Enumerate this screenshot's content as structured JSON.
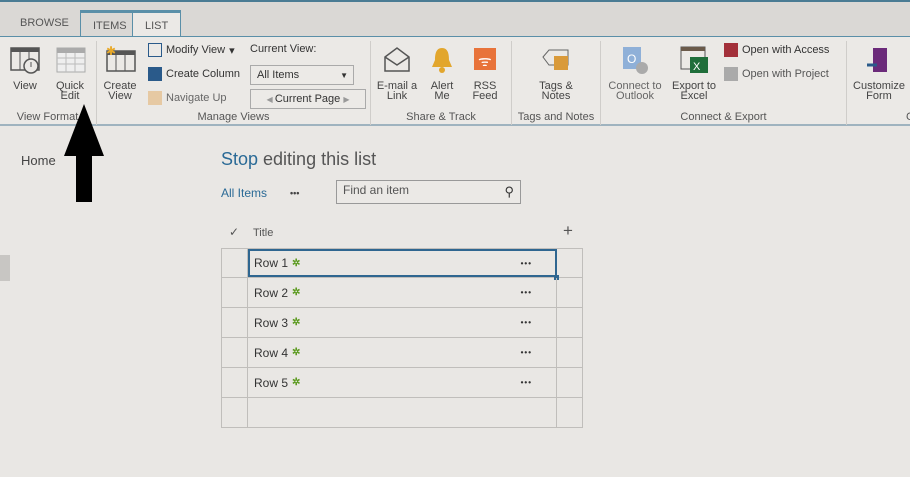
{
  "tabs": [
    {
      "label": "BROWSE"
    },
    {
      "label": "ITEMS"
    },
    {
      "label": "LIST"
    }
  ],
  "ribbon": {
    "view_format": {
      "label": "View Format",
      "view": "View",
      "quick_edit": "Quick Edit"
    },
    "manage_views": {
      "label": "Manage Views",
      "create_view": "Create View",
      "modify_view": "Modify View",
      "create_column": "Create Column",
      "navigate_up": "Navigate Up",
      "current_view_label": "Current View:",
      "current_view_value": "All Items",
      "current_page": "Current Page"
    },
    "share_track": {
      "label": "Share & Track",
      "email": "E-mail a Link",
      "alert": "Alert Me",
      "rss": "RSS Feed"
    },
    "tags": {
      "label": "Tags and Notes",
      "tags_notes": "Tags & Notes"
    },
    "connect": {
      "label": "Connect & Export",
      "outlook": "Connect to Outlook",
      "excel": "Export to Excel",
      "access": "Open with Access",
      "project": "Open with Project"
    },
    "customize": {
      "label": "C",
      "form": "Customize Form"
    }
  },
  "nav": {
    "home": "Home"
  },
  "main": {
    "stop": "Stop",
    "title_rest": " editing this list",
    "view": "All Items",
    "dots": "•••",
    "search_placeholder": "Find an item",
    "col_check": "✓",
    "col_title": "Title",
    "add": "+",
    "rows": [
      {
        "title": "Row 1"
      },
      {
        "title": "Row 2"
      },
      {
        "title": "Row 3"
      },
      {
        "title": "Row 4"
      },
      {
        "title": "Row 5"
      }
    ],
    "new_mark": "✲",
    "more": "•••"
  }
}
